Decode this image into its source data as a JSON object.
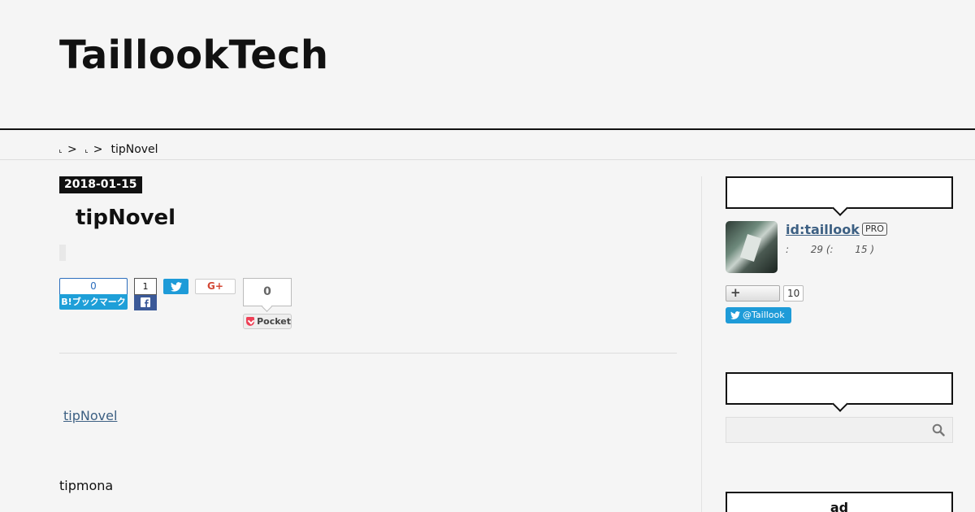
{
  "header": {
    "blog_title": "TaillookTech"
  },
  "breadcrumb": {
    "separator": ">",
    "current": "tipNovel"
  },
  "entry": {
    "date": "2018-01-15",
    "title": "tipNovel",
    "link_text": "tipNovel",
    "body_text": "tipmona"
  },
  "share": {
    "hatena_count": "0",
    "hatena_label": "B!ブックマーク",
    "facebook_count": "1",
    "gplus_label": "G+",
    "pocket_count": "0",
    "pocket_label": "Pocket"
  },
  "sidebar": {
    "profile": {
      "user_id": "id:taillook",
      "badge": "PRO",
      "meta": ":       29 (:       15 )",
      "subscribe_label": "+",
      "subscribe_count": "10",
      "twitter_handle": "@Taillook"
    },
    "ad_title": "ad"
  },
  "colors": {
    "background": "#f5f5f5",
    "link": "#3d6083",
    "hatena": "#1e9fd8",
    "facebook": "#3b5998",
    "twitter": "#1e9bd8",
    "pocket": "#ee4056"
  }
}
